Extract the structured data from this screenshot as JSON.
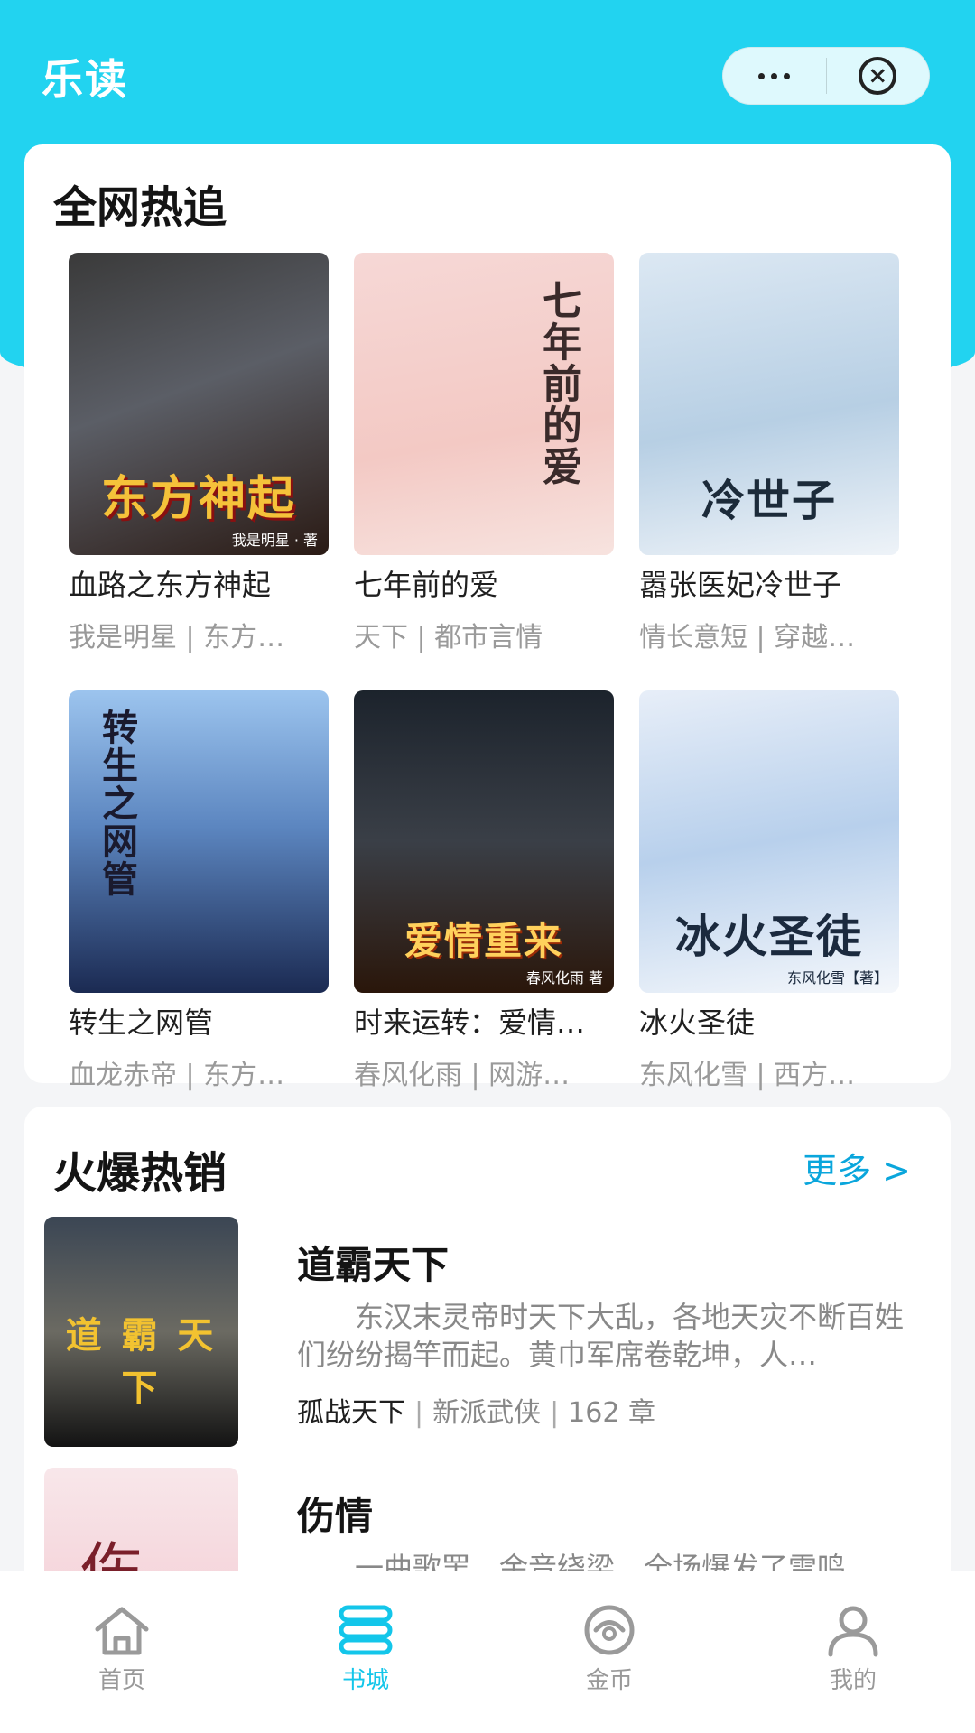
{
  "header": {
    "app_title": "乐读",
    "menu_icon": "more-dots-icon",
    "close_icon": "close-circle-icon"
  },
  "hot_section": {
    "title": "全网热追",
    "books": [
      {
        "name": "血路之东方神起",
        "meta": "我是明星 | 东方…",
        "cover_text": "东方神起",
        "cover_author": "我是明星 · 著"
      },
      {
        "name": "七年前的爱",
        "meta": "天下 | 都市言情",
        "cover_text": "七年前的爱",
        "cover_author": ""
      },
      {
        "name": "嚣张医妃冷世子",
        "meta": "情长意短 | 穿越…",
        "cover_text": "冷世子",
        "cover_author": ""
      },
      {
        "name": "转生之网管",
        "meta": "血龙赤帝 | 东方…",
        "cover_text": "转生之网管",
        "cover_author": ""
      },
      {
        "name": "时来运转：爱情…",
        "meta": "春风化雨 | 网游…",
        "cover_text": "爱情重来",
        "cover_author": "春风化雨 著"
      },
      {
        "name": "冰火圣徒",
        "meta": "东风化雪 | 西方…",
        "cover_text": "冰火圣徒",
        "cover_author": "东风化雪【著】"
      }
    ]
  },
  "sales_section": {
    "title": "火爆热销",
    "more_label": "更多 >",
    "items": [
      {
        "title": "道霸天下",
        "desc": "东汉末灵帝时天下大乱，各地天灾不断百姓们纷纷揭竿而起。黄巾军席卷乾坤，人…",
        "author": "孤战天下",
        "genre": "新派武侠",
        "chapters": "162 章",
        "cover_text": "道 霸 天 下"
      },
      {
        "title": "伤情",
        "desc": "一曲歌罢，余音绕梁，全场爆发了雷鸣…",
        "author": "",
        "genre": "",
        "chapters": "",
        "cover_text": "伤"
      }
    ]
  },
  "tabbar": {
    "tabs": [
      {
        "label": "首页",
        "icon": "home-icon",
        "active": false
      },
      {
        "label": "书城",
        "icon": "bookstore-icon",
        "active": true
      },
      {
        "label": "金币",
        "icon": "coin-icon",
        "active": false
      },
      {
        "label": "我的",
        "icon": "profile-icon",
        "active": false
      }
    ]
  },
  "colors": {
    "brand": "#22d3f0",
    "active_tab": "#13c6ea",
    "link": "#0aa6dc"
  }
}
